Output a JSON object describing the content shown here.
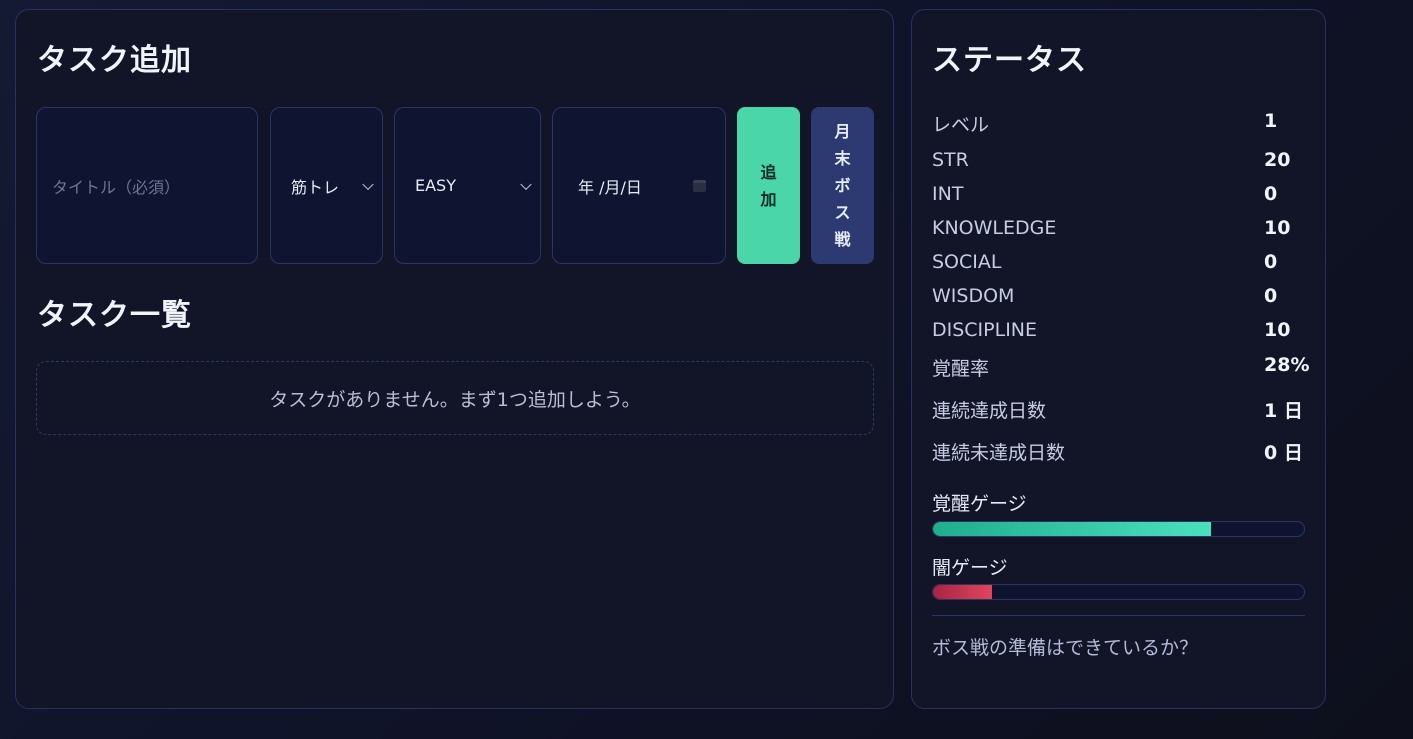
{
  "task_add": {
    "title": "タスク追加",
    "title_input": {
      "placeholder": "タイトル（必須）",
      "value": ""
    },
    "category_select": {
      "selected": "筋トレ"
    },
    "difficulty_select": {
      "selected": "EASY"
    },
    "date_input": {
      "display": "年 /月/日"
    },
    "add_button_label": "追加",
    "boss_button_label": "月末ボス戦"
  },
  "task_list": {
    "title": "タスク一覧",
    "empty_message": "タスクがありません。まず1つ追加しよう。"
  },
  "status": {
    "title": "ステータス",
    "rows": [
      {
        "label": "レベル",
        "value": "1"
      },
      {
        "label": "STR",
        "value": "20"
      },
      {
        "label": "INT",
        "value": "0"
      },
      {
        "label": "KNOWLEDGE",
        "value": "10"
      },
      {
        "label": "SOCIAL",
        "value": "0"
      },
      {
        "label": "WISDOM",
        "value": "0"
      },
      {
        "label": "DISCIPLINE",
        "value": "10"
      },
      {
        "label": "覚醒率",
        "value": "28%"
      },
      {
        "label": "連続達成日数",
        "value": "1 日"
      },
      {
        "label": "連続未達成日数",
        "value": "0 日"
      }
    ],
    "awakening_gauge": {
      "label": "覚醒ゲージ",
      "fill_fraction": 0.75,
      "color": "#4be0bd"
    },
    "dark_gauge": {
      "label": "闇ゲージ",
      "fill_fraction": 0.16,
      "color": "#e0455e"
    },
    "boss_message": "ボス戦の準備はできているか？"
  },
  "colors": {
    "accent_green": "#4ad6a8",
    "boss_button": "#2d3a72",
    "panel_bg": "#121528"
  }
}
